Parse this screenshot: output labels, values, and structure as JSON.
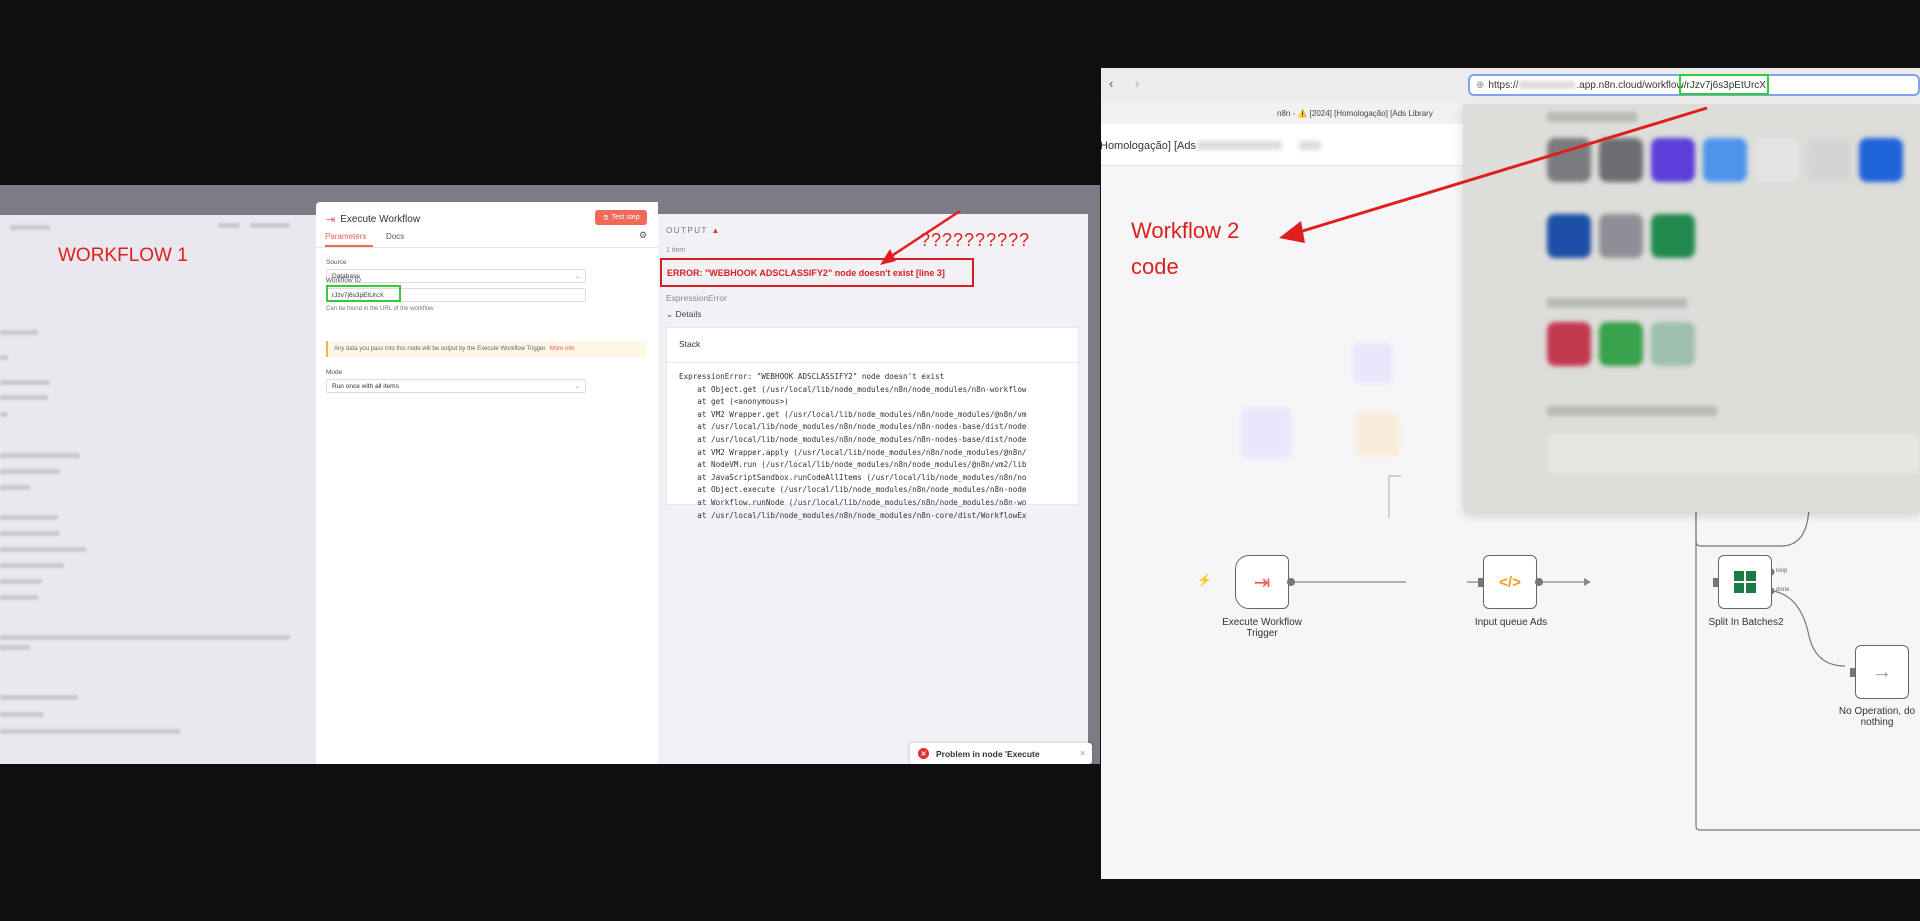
{
  "annotations": {
    "workflow1_label": "WORKFLOW 1",
    "question_marks": "??????????",
    "workflow2_label_line1": "Workflow 2",
    "workflow2_label_line2": "code",
    "color_red": "#e01e1e",
    "color_highlight_green": "#33cc33"
  },
  "execute_panel": {
    "title": "Execute Workflow",
    "test_step": "Test step",
    "tabs": [
      "Parameters",
      "Docs"
    ],
    "source_label": "Source",
    "source_value": "Database",
    "workflow_id_label": "Workflow ID",
    "workflow_id_value": "rJzv7j6s3pEtUrcX",
    "workflow_id_hint": "Can be found in the URL of the workflow",
    "notice_text": "Any data you pass into this node will be output by the Execute Workflow Trigger.",
    "notice_link": "More info",
    "mode_label": "Mode",
    "mode_value": "Run once with all items"
  },
  "output": {
    "label": "OUTPUT",
    "item_count": "1 item",
    "error_title": "ERROR: \"WEBHOOK ADSCLASSIFY2\" node doesn't exist [line 3]",
    "error_type": "ExpressionError",
    "details_label": "Details",
    "stack_label": "Stack",
    "stack_lines": [
      "ExpressionError: \"WEBHOOK ADSCLASSIFY2\" node doesn't exist",
      "    at Object.get (/usr/local/lib/node_modules/n8n/node_modules/n8n-workflow",
      "    at get (<anonymous>)",
      "    at VM2 Wrapper.get (/usr/local/lib/node_modules/n8n/node_modules/@n8n/vm",
      "    at /usr/local/lib/node_modules/n8n/node_modules/n8n-nodes-base/dist/node",
      "    at /usr/local/lib/node_modules/n8n/node_modules/n8n-nodes-base/dist/node",
      "    at VM2 Wrapper.apply (/usr/local/lib/node_modules/n8n/node_modules/@n8n/",
      "    at NodeVM.run (/usr/local/lib/node_modules/n8n/node_modules/@n8n/vm2/lib",
      "    at JavaScriptSandbox.runCodeAllItems (/usr/local/lib/node_modules/n8n/no",
      "    at Object.execute (/usr/local/lib/node_modules/n8n/node_modules/n8n-node",
      "    at Workflow.runNode (/usr/local/lib/node_modules/n8n/node_modules/n8n-wo",
      "    at /usr/local/lib/node_modules/n8n/node_modules/n8n-core/dist/WorkflowEx"
    ],
    "toast_text": "Problem in node 'Execute"
  },
  "browser": {
    "url_prefix": "https://",
    "url_domain": ".app.n8n.cloud/workflow/",
    "url_id": "rJzv7j6s3pEtUrcX",
    "tab_title": "n8n - ⚠️ [2024] [Homologação] [Ads Library",
    "workflow_title": "Homologação] [Ads"
  },
  "canvas": {
    "nodes": [
      {
        "label_line1": "Execute Workflow",
        "label_line2": "Trigger",
        "icon": "exit-arrow-icon"
      },
      {
        "label_line1": "Input queue Ads",
        "label_line2": "",
        "icon": "code-icon"
      },
      {
        "label_line1": "Split In Batches2",
        "label_line2": "",
        "icon": "grid-icon"
      },
      {
        "label_line1": "No Operation, do",
        "label_line2": "nothing",
        "icon": "arrow-right-icon"
      }
    ],
    "loop_label": "loop",
    "done_label": "done"
  }
}
